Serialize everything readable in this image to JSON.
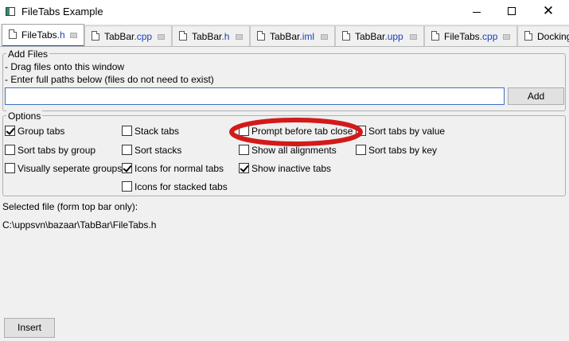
{
  "window": {
    "title": "FileTabs Example",
    "close_glyph": "✕"
  },
  "tabs": [
    {
      "name": "FileTabs",
      "ext": ".h"
    },
    {
      "name": "TabBar",
      "ext": ".cpp"
    },
    {
      "name": "TabBar",
      "ext": ".h"
    },
    {
      "name": "TabBar",
      "ext": ".iml"
    },
    {
      "name": "TabBar",
      "ext": ".upp"
    },
    {
      "name": "FileTabs",
      "ext": ".cpp"
    },
    {
      "name": "Docking",
      "ext": ""
    }
  ],
  "add_files": {
    "legend": "Add Files",
    "hint1": "- Drag files onto this window",
    "hint2": "- Enter full paths below (files do not need to exist)",
    "path_value": "",
    "add_label": "Add"
  },
  "options": {
    "legend": "Options",
    "group_tabs": {
      "label": "Group tabs",
      "checked": true
    },
    "sort_tabs_by_group": {
      "label": "Sort tabs by group",
      "checked": false
    },
    "visually_separate_groups": {
      "label": "Visually seperate groups",
      "checked": false
    },
    "stack_tabs": {
      "label": "Stack tabs",
      "checked": false
    },
    "sort_stacks": {
      "label": "Sort stacks",
      "checked": false
    },
    "icons_normal_tabs": {
      "label": "Icons for normal tabs",
      "checked": true
    },
    "icons_stacked_tabs": {
      "label": "Icons for stacked tabs",
      "checked": false
    },
    "prompt_before_close": {
      "label": "Prompt before tab close",
      "checked": false
    },
    "show_all_alignments": {
      "label": "Show all alignments",
      "checked": false
    },
    "show_inactive_tabs": {
      "label": "Show inactive tabs",
      "checked": true
    },
    "sort_by_value": {
      "label": "Sort tabs by value",
      "checked": false
    },
    "sort_by_key": {
      "label": "Sort tabs by key",
      "checked": false
    }
  },
  "selected": {
    "label": "Selected file (form top bar only):",
    "path": "C:\\uppsvn\\bazaar\\TabBar\\FileTabs.h"
  },
  "insert_label": "Insert",
  "colors": {
    "annotation": "#d21a1a",
    "active_tab_underline": "#1b4fb4",
    "input_border": "#3f6fc4"
  }
}
